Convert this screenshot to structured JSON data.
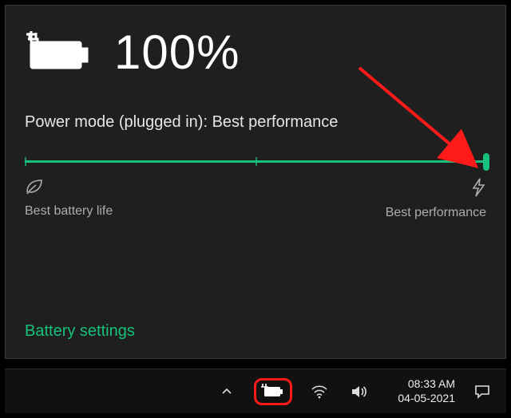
{
  "battery": {
    "percent_text": "100%",
    "mode_line": "Power mode (plugged in): Best performance",
    "slider_position_percent": 100,
    "label_left": "Best battery life",
    "label_right": "Best performance",
    "settings_link": "Battery settings"
  },
  "taskbar": {
    "time": "08:33 AM",
    "date": "04-05-2021"
  },
  "colors": {
    "accent": "#17c07c",
    "annotation": "#ff1a1a"
  }
}
